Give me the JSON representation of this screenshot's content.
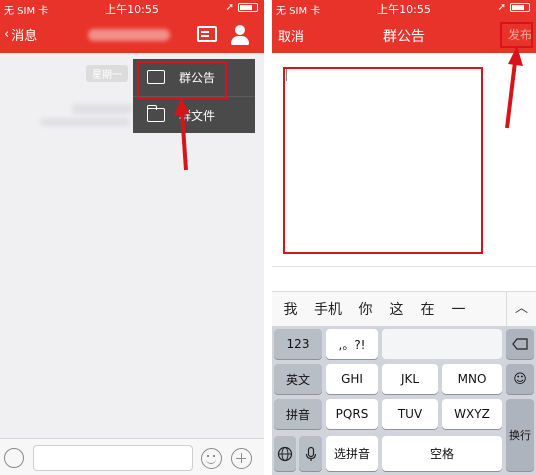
{
  "status": {
    "carrier": "无 SIM 卡",
    "time": "上午10:55"
  },
  "left": {
    "nav": {
      "back_label": "消息"
    },
    "chat": {
      "time_chip": "星期一"
    },
    "menu": {
      "items": [
        {
          "label": "群公告",
          "icon": "announcement-icon"
        },
        {
          "label": "群文件",
          "icon": "folder-icon"
        }
      ]
    },
    "input_bar": {
      "placeholder": ""
    }
  },
  "right": {
    "nav": {
      "cancel_label": "取消",
      "title": "群公告",
      "publish_label": "发布"
    },
    "candidates": [
      "我",
      "手机",
      "你",
      "这",
      "在",
      "一"
    ],
    "keyboard": {
      "row1": {
        "left": "123",
        "key1": ",。?!"
      },
      "row2": {
        "left": "英文",
        "key1": "GHI",
        "key2": "JKL",
        "key3": "MNO"
      },
      "row3": {
        "left": "拼音",
        "key1": "PQRS",
        "key2": "TUV",
        "key3": "WXYZ"
      },
      "row4": {
        "pinyin_select": "选拼音",
        "space": "空格"
      },
      "return_label": "换行"
    }
  },
  "colors": {
    "brand_red": "#e8332a",
    "highlight_red": "#d7141a",
    "menu_bg": "#4a4a4a"
  }
}
